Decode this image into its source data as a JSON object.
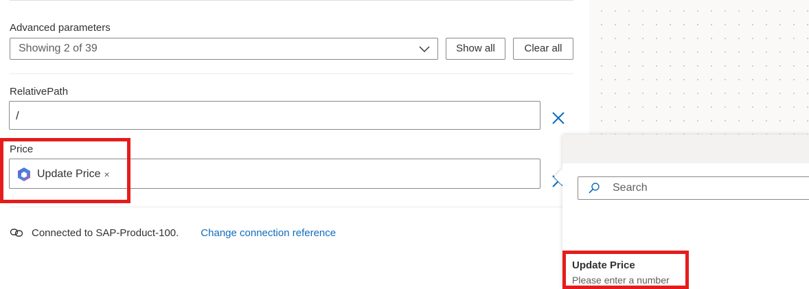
{
  "advanced": {
    "label": "Advanced parameters",
    "select_value": "Showing 2 of 39",
    "show_all": "Show all",
    "clear_all": "Clear all"
  },
  "relative_path": {
    "label": "RelativePath",
    "value": "/"
  },
  "price": {
    "label": "Price",
    "token": "Update Price",
    "token_remove": "×"
  },
  "connection": {
    "text": "Connected to SAP-Product-100.",
    "link": "Change connection reference"
  },
  "popup": {
    "search_placeholder": "Search",
    "item_title": "Update Price",
    "item_subtitle": "Please enter a number"
  },
  "colors": {
    "accent": "#0f6cbd",
    "highlight": "#e51c1c"
  },
  "icons": {
    "chevron": "chevron-down-icon",
    "clear": "close-icon",
    "token": "copilot-icon",
    "connection": "link-icon",
    "search": "search-icon"
  }
}
